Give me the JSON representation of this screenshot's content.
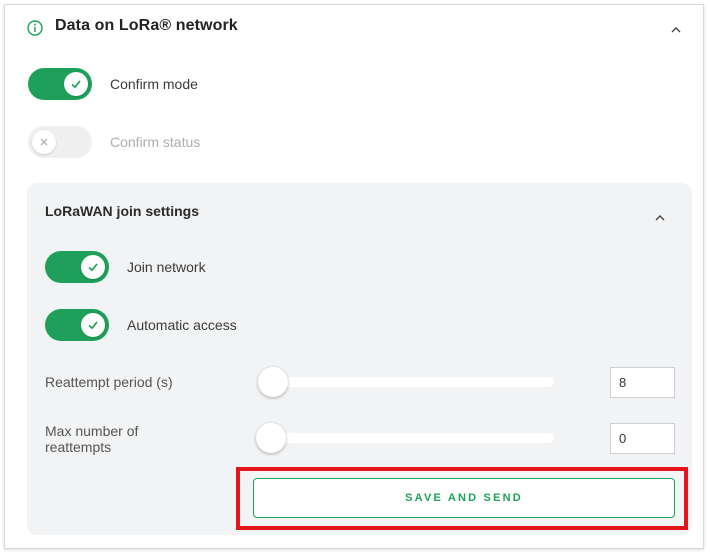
{
  "section": {
    "title": "Data on LoRa® network",
    "info_icon": "info-icon",
    "collapse_icon": "chevron-up-icon"
  },
  "toggles": {
    "confirm_mode": {
      "label": "Confirm mode",
      "checked": true
    },
    "confirm_status": {
      "label": "Confirm status",
      "checked": false,
      "disabled": true
    }
  },
  "join_settings": {
    "title": "LoRaWAN join settings",
    "collapse_icon": "chevron-up-icon",
    "join_network": {
      "label": "Join network",
      "checked": true
    },
    "automatic_access": {
      "label": "Automatic access",
      "checked": true
    },
    "reattempt_period": {
      "label": "Reattempt period (s)",
      "value": "8",
      "slider_fraction": 0
    },
    "max_reattempts": {
      "label_line1": "Max number of",
      "label_line2": "reattempts",
      "value": "0",
      "slider_fraction": 0
    }
  },
  "actions": {
    "save_send_label": "SAVE AND SEND"
  },
  "colors": {
    "accent": "#1fa05a",
    "highlight": "#e3141a",
    "panel_bg": "#f2f3f4"
  }
}
